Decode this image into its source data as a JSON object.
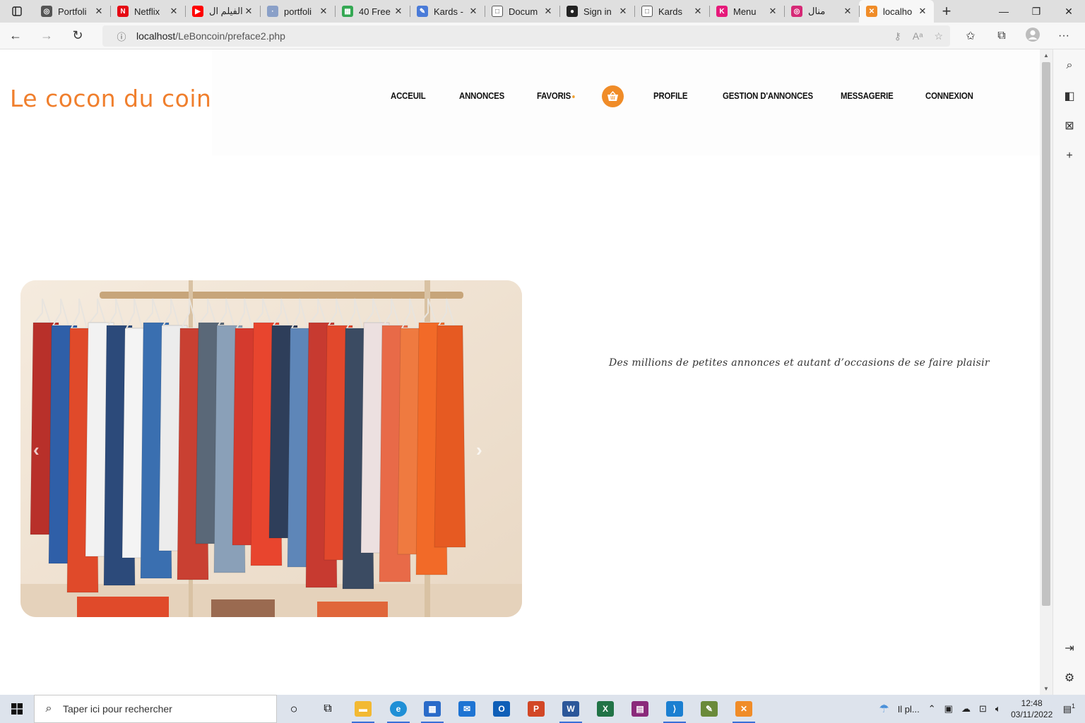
{
  "browser": {
    "tabs": [
      {
        "label": "Portfoli",
        "icon": "portfolio-icon",
        "color": "#555555",
        "glyph": "◎"
      },
      {
        "label": "Netflix",
        "icon": "netflix-icon",
        "color": "#e50914",
        "glyph": "N"
      },
      {
        "label": "الفيلم ال",
        "icon": "youtube-icon",
        "color": "#ff0000",
        "glyph": "▶"
      },
      {
        "label": "portfoli",
        "icon": "page-icon",
        "color": "#8aa0c8",
        "glyph": "·"
      },
      {
        "label": "40 Free",
        "icon": "sheets-icon",
        "color": "#34a853",
        "glyph": "▦"
      },
      {
        "label": "Kards -",
        "icon": "kards-icon",
        "color": "#4a7bd8",
        "glyph": "✎"
      },
      {
        "label": "Docum",
        "icon": "document-icon",
        "color": "#ffffff",
        "glyph": "□"
      },
      {
        "label": "Sign in",
        "icon": "github-icon",
        "color": "#222222",
        "glyph": "●"
      },
      {
        "label": "Kards",
        "icon": "document-icon",
        "color": "#ffffff",
        "glyph": "□"
      },
      {
        "label": "Menu",
        "icon": "k-icon",
        "color": "#e6197a",
        "glyph": "K"
      },
      {
        "label": "منال",
        "icon": "instagram-icon",
        "color": "#d62976",
        "glyph": "◎"
      },
      {
        "label": "localho",
        "icon": "xampp-icon",
        "color": "#f08c28",
        "glyph": "✕",
        "active": true
      }
    ],
    "new_tab": "+",
    "url_host": "localhost",
    "url_path": "/LeBoncoin/preface2.php"
  },
  "site": {
    "logo": "Le cocon du coin",
    "nav": {
      "acceuil": "ACCEUIL",
      "annonces": "ANNONCES",
      "favoris": "FAVORIS",
      "profile": "PROFILE",
      "gestion": "GESTION D'ANNONCES",
      "messagerie": "MESSAGERIE",
      "connexion": "CONNEXION"
    },
    "tagline": "Des millions de petites annonces et autant d’occasions de se faire plaisir",
    "carousel": {
      "prev": "‹",
      "next": "›"
    }
  },
  "taskbar": {
    "search_placeholder": "Taper ici pour rechercher",
    "weather": "Il pl...",
    "time": "12:48",
    "date": "03/11/2022",
    "notifications": "1"
  }
}
